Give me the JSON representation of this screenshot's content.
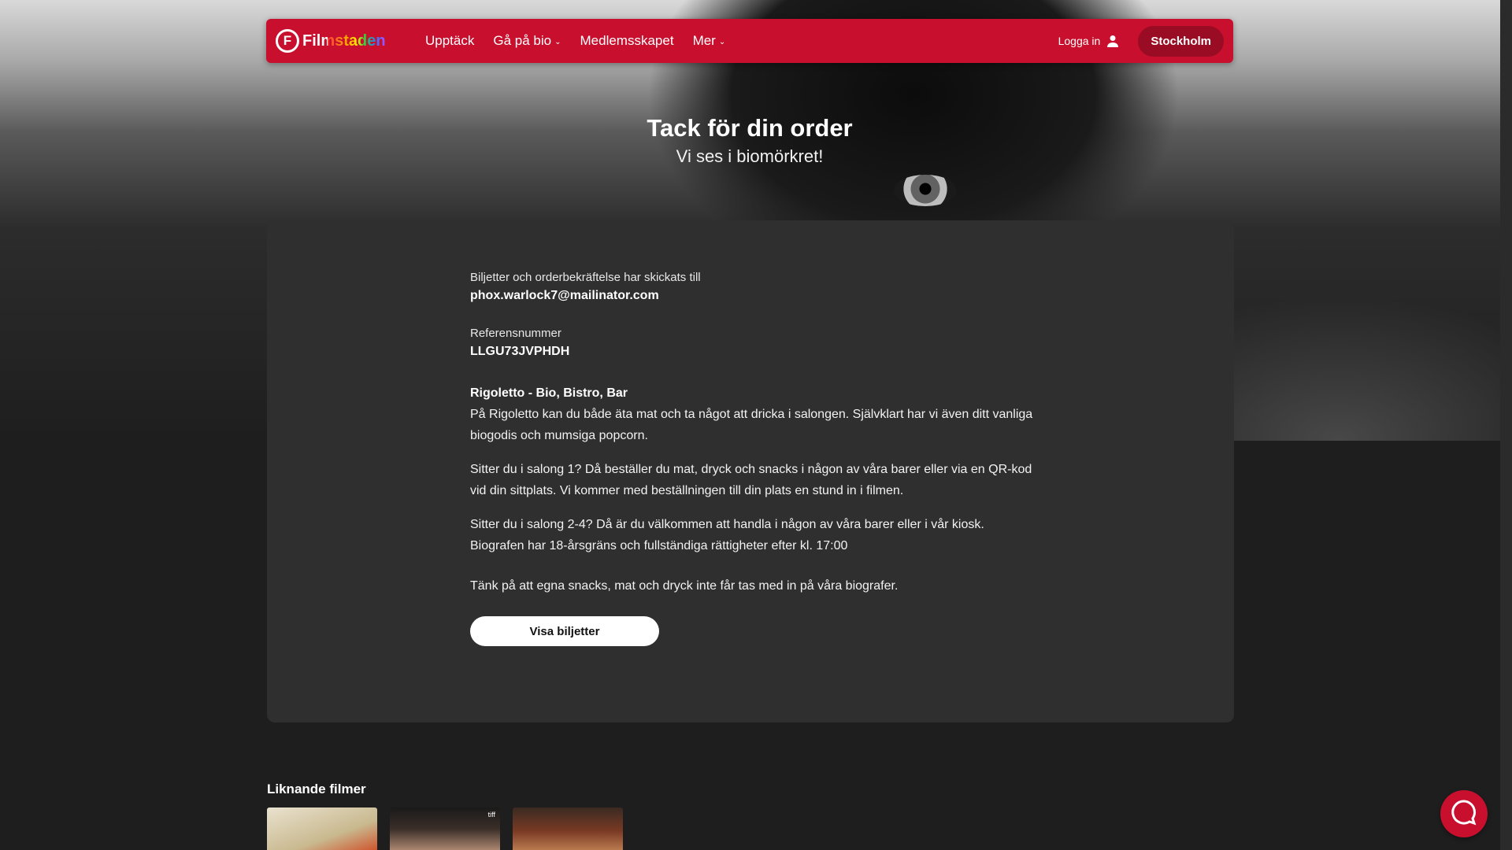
{
  "nav": {
    "logo_letter": "F",
    "logo_text": "Filmstaden",
    "items": [
      {
        "label": "Upptäck",
        "has_dropdown": false
      },
      {
        "label": "Gå på bio",
        "has_dropdown": true
      },
      {
        "label": "Medlemsskapet",
        "has_dropdown": false
      },
      {
        "label": "Mer",
        "has_dropdown": true
      }
    ],
    "login_label": "Logga in",
    "city_label": "Stockholm",
    "chevron": "⌄"
  },
  "header": {
    "title": "Tack för din order",
    "subtitle": "Vi ses i biomörkret!"
  },
  "order": {
    "sent_label": "Biljetter och orderbekräftelse har skickats till",
    "email": "phox.warlock7@mailinator.com",
    "ref_label": "Referensnummer",
    "ref_value": "LLGU73JVPHDH",
    "venue_title": "Rigoletto - Bio, Bistro, Bar",
    "para1": "På Rigoletto kan du både äta mat och ta något att dricka i salongen. Självklart har vi även ditt vanliga biogodis och mumsiga popcorn.",
    "para2": "Sitter du i salong 1? Då beställer du mat, dryck och snacks i någon av våra barer eller via en QR-kod vid din sittplats. Vi kommer med beställningen till din plats en stund in i filmen.",
    "para3": "Sitter du i salong 2-4? Då är du välkommen att handla i någon av våra barer eller i vår kiosk.",
    "para4": "Biografen har 18-årsgräns och fullständiga rättigheter efter kl. 17:00",
    "para5": "Tänk på att egna snacks, mat och dryck inte får tas med in på våra biografer.",
    "button_label": "Visa biljetter"
  },
  "similar": {
    "title": "Liknande filmer",
    "posters": [
      {
        "tag": ""
      },
      {
        "tag": "tiff"
      },
      {
        "tag": ""
      }
    ]
  },
  "colors": {
    "brand": "#c8102e",
    "card": "#2f2f2f",
    "background": "#1e1e1e"
  },
  "icons": {
    "user": "user-icon",
    "help": "chat-bubble-icon"
  }
}
